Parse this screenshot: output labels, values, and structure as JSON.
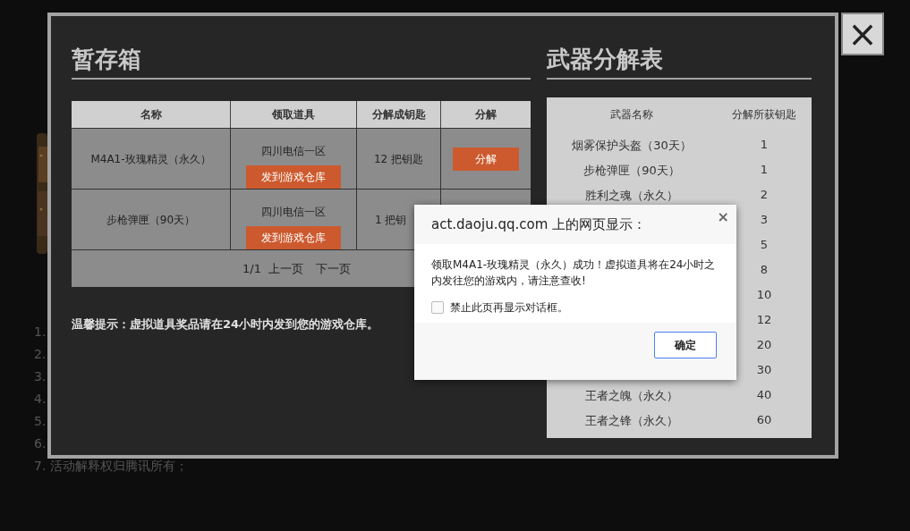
{
  "background_page": {
    "list_items": [
      "1.",
      "2.",
      "3.",
      "4.",
      "5.",
      "6.",
      "7. 活动解释权归腾讯所有；"
    ]
  },
  "modal": {
    "close": "×",
    "storage": {
      "title": "暂存箱",
      "columns": [
        "名称",
        "领取道具",
        "分解成钥匙",
        "分解"
      ],
      "rows": [
        {
          "name": "M4A1-玫瑰精灵（永久）",
          "server": "四川电信一区",
          "send": "发到游戏仓库",
          "keys": "12 把钥匙",
          "decompose": "分解"
        },
        {
          "name": "步枪弹匣（90天）",
          "server": "四川电信一区",
          "send": "发到游戏仓库",
          "keys": "1 把钥"
        }
      ],
      "pagination": {
        "page": "1/1",
        "prev": "上一页",
        "next": "下一页"
      },
      "tip": "温馨提示：虚拟道具奖品请在24小时内发到您的游戏仓库。"
    },
    "decompose_table": {
      "title": "武器分解表",
      "columns": [
        "武器名称",
        "分解所获钥匙"
      ],
      "rows": [
        {
          "name": "烟雾保护头盔（30天）",
          "keys": "1"
        },
        {
          "name": "步枪弹匣（90天）",
          "keys": "1"
        },
        {
          "name": "胜利之魂（永久）",
          "keys": "2"
        },
        {
          "keys": "3"
        },
        {
          "keys": "5"
        },
        {
          "keys": "8"
        },
        {
          "keys": "10"
        },
        {
          "keys": "12"
        },
        {
          "keys": "20"
        },
        {
          "keys": "30"
        },
        {
          "name": "王者之魄（永久）",
          "keys": "40"
        },
        {
          "name": "王者之锋（永久）",
          "keys": "60"
        }
      ]
    }
  },
  "dialog": {
    "title": "act.daoju.qq.com 上的网页显示：",
    "close": "×",
    "message": "领取M4A1-玫瑰精灵（永久）成功！虚拟道具将在24小时之内发往您的游戏内，请注意查收!",
    "suppress": {
      "label": "禁止此页再显示对话框。",
      "checked": false
    },
    "ok": "确定"
  }
}
